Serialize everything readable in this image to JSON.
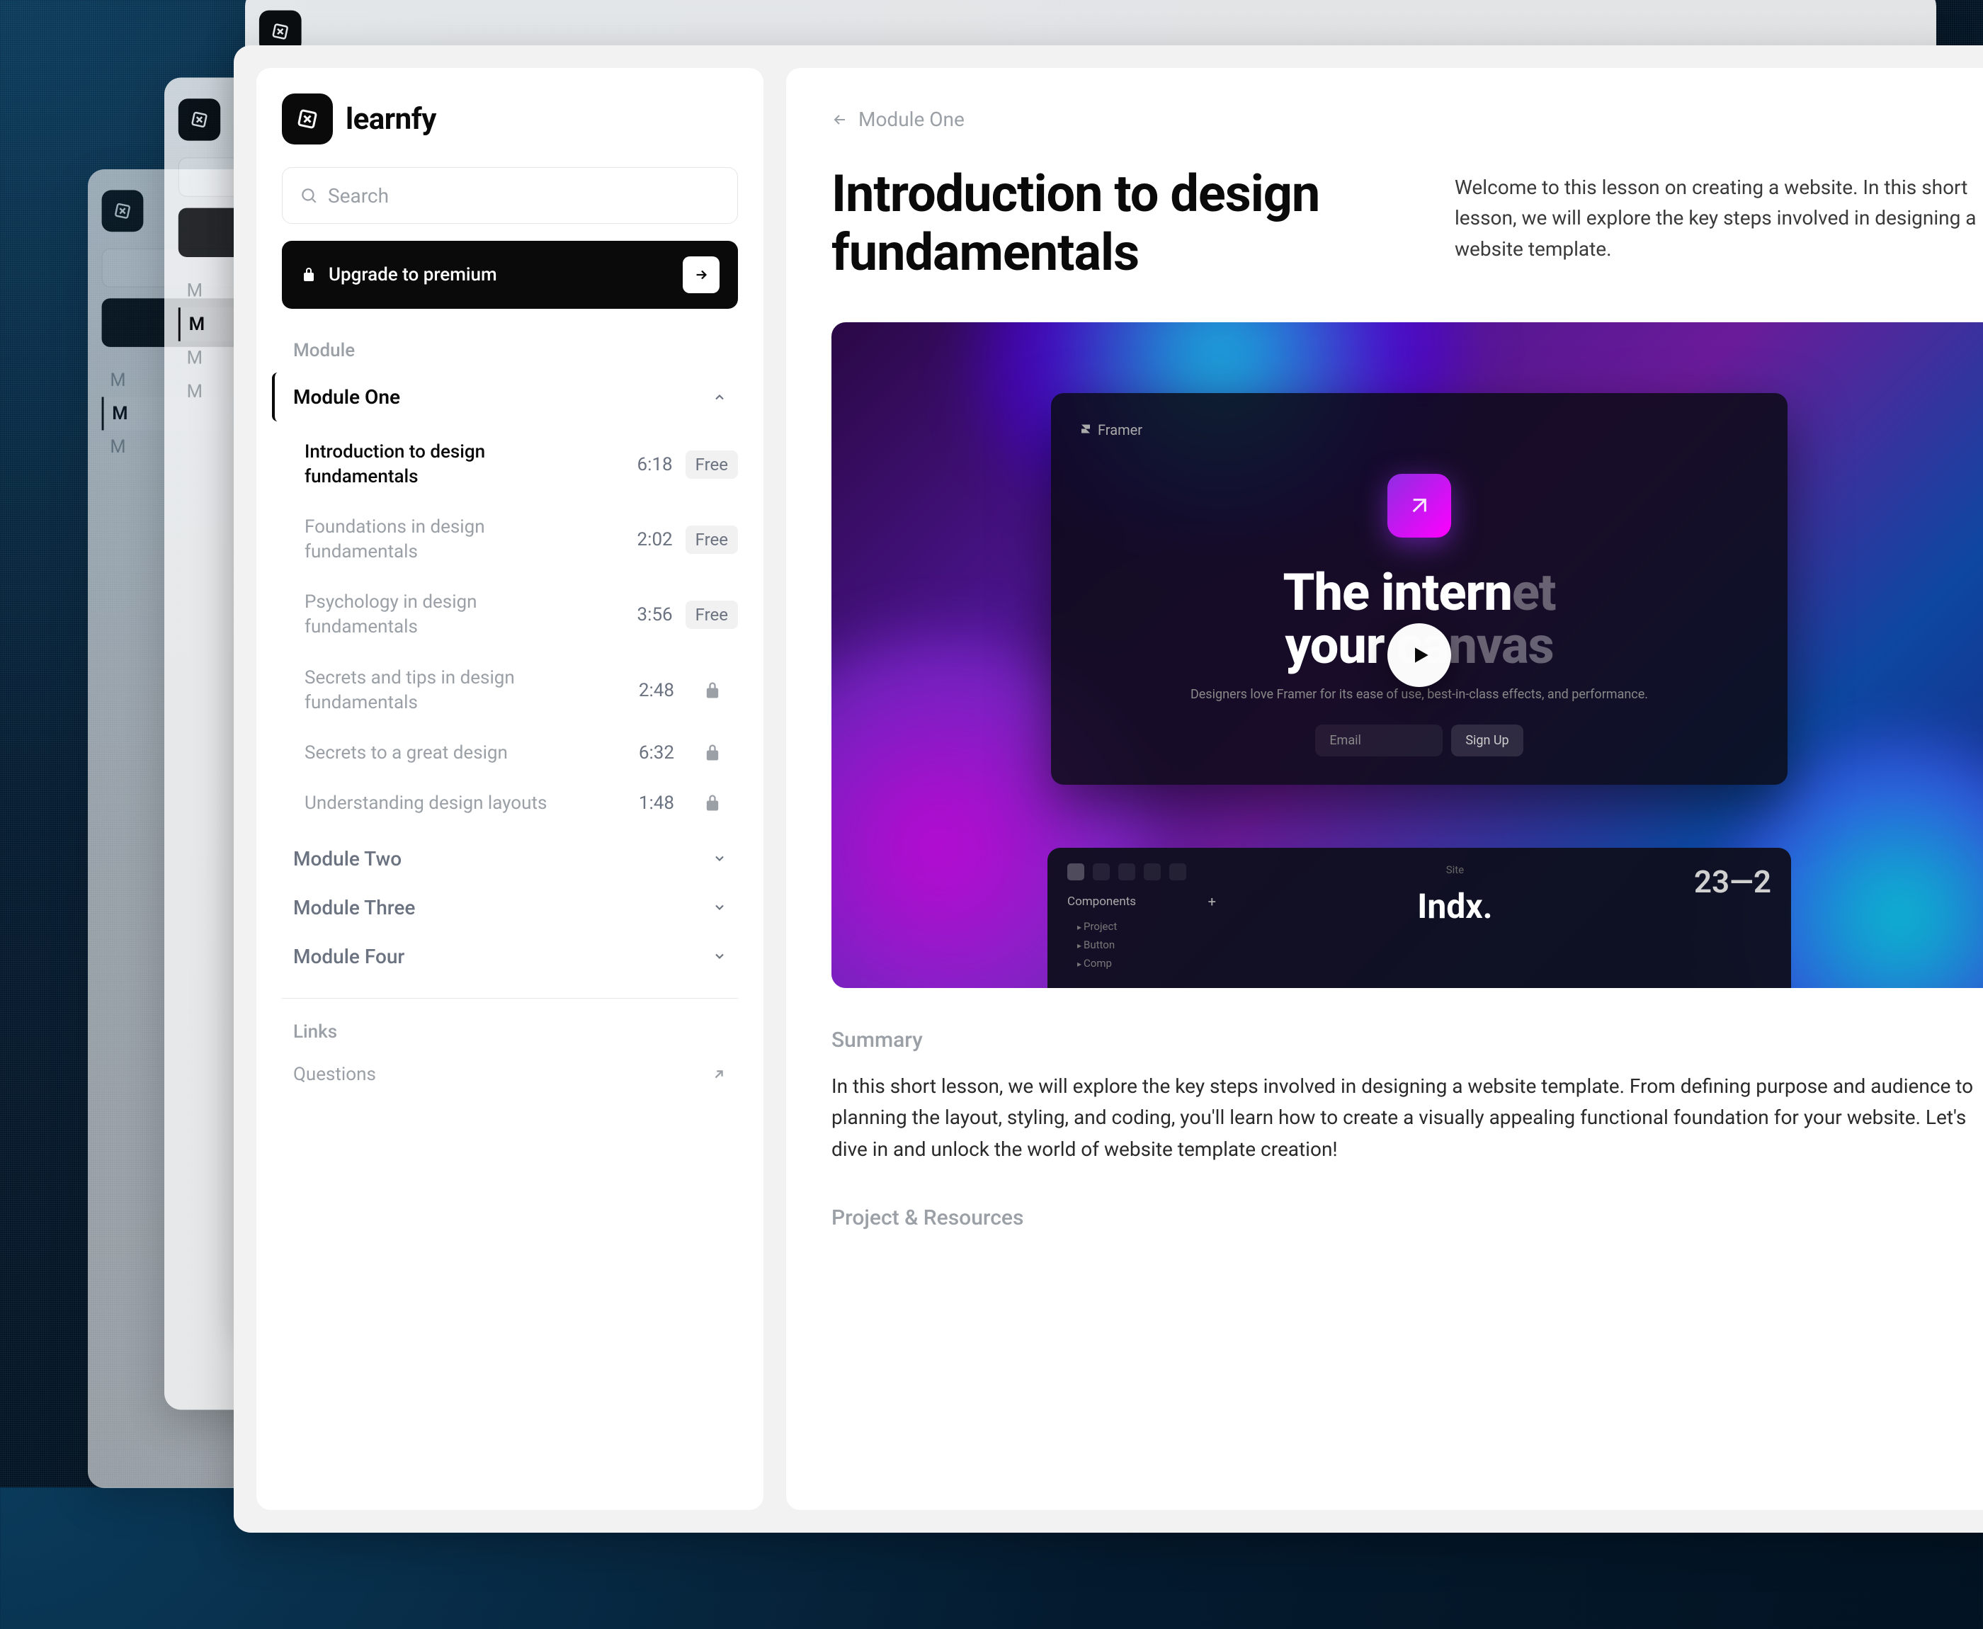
{
  "brand": {
    "name": "learnfy"
  },
  "search": {
    "placeholder": "Search"
  },
  "premium": {
    "label": "Upgrade to premium"
  },
  "sidebar": {
    "module_section_label": "Module",
    "modules": [
      {
        "title": "Module One",
        "expanded": true,
        "lessons": [
          {
            "title": "Introduction to design fundamentals",
            "time": "6:18",
            "status": "Free",
            "active": true
          },
          {
            "title": "Foundations in design fundamentals",
            "time": "2:02",
            "status": "Free"
          },
          {
            "title": "Psychology in design fundamentals",
            "time": "3:56",
            "status": "Free"
          },
          {
            "title": "Secrets and tips in design fundamentals",
            "time": "2:48",
            "status": "locked"
          },
          {
            "title": "Secrets to a great design",
            "time": "6:32",
            "status": "locked"
          },
          {
            "title": "Understanding design layouts",
            "time": "1:48",
            "status": "locked"
          }
        ]
      },
      {
        "title": "Module Two",
        "expanded": false
      },
      {
        "title": "Module Three",
        "expanded": false
      },
      {
        "title": "Module Four",
        "expanded": false
      }
    ],
    "links_section_label": "Links",
    "links": [
      {
        "title": "Questions"
      }
    ]
  },
  "breadcrumb": {
    "label": "Module One"
  },
  "lesson": {
    "title": "Introduction to design fundamentals",
    "intro": "Welcome to this lesson on creating a website. In this short lesson, we will explore the key steps involved in designing a website template."
  },
  "video": {
    "framer_tag": "Framer",
    "headline_line1_a": "The intern",
    "headline_line1_b": "et",
    "headline_line2_a": "your ",
    "headline_line2_b": "canvas",
    "subtitle": "Designers love Framer for its ease of use, best-in-class effects, and performance.",
    "email_placeholder": "Email",
    "signup_label": "Sign Up",
    "toolbar": {
      "components_label": "Components",
      "items": [
        "Project",
        "Button",
        "Comp"
      ],
      "site_label": "Site",
      "indx_label": "Indx.",
      "date_text": "23—2"
    }
  },
  "summary": {
    "label": "Summary",
    "text": "In this short lesson, we will explore the key steps involved in designing a website template. From defining purpose and audience to planning the layout, styling, and coding, you'll learn how to create a visually appealing functional foundation for your website. Let's dive in and unlock the world of website template creation!"
  },
  "resources": {
    "label": "Project & Resources"
  }
}
